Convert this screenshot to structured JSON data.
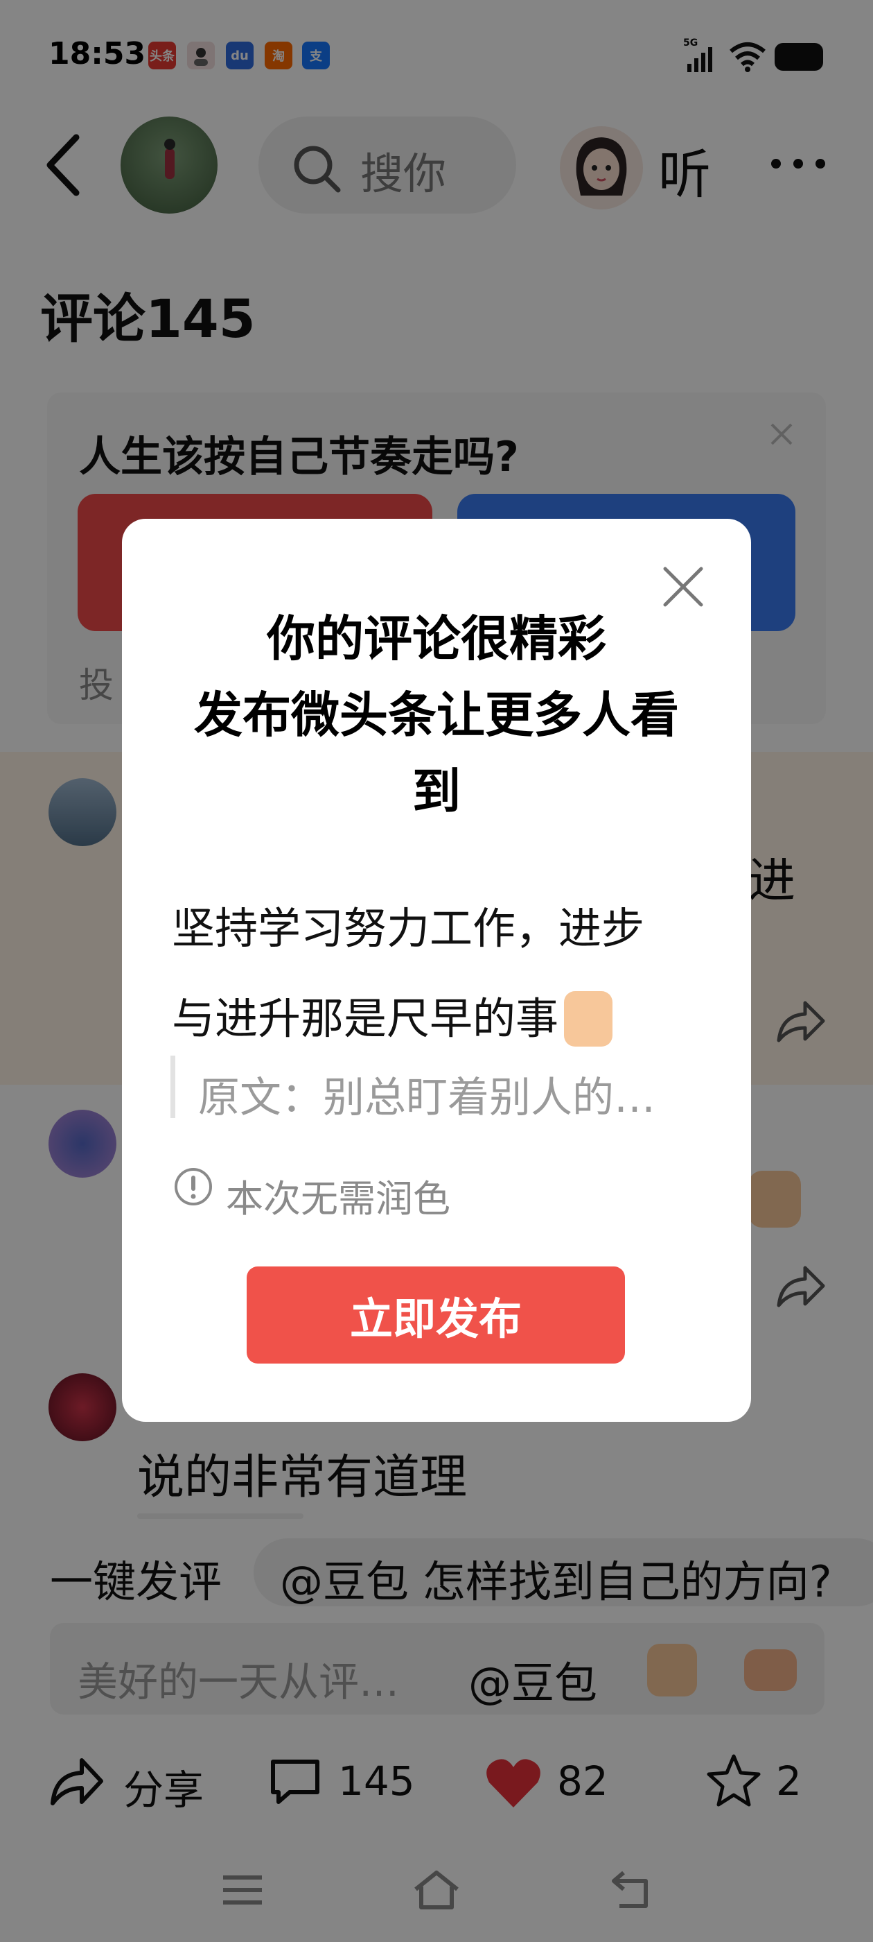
{
  "status_bar": {
    "time": "18:53",
    "apps": [
      "toutiao-icon",
      "avatar-icon",
      "baidu-icon",
      "taobao-icon",
      "alipay-icon"
    ],
    "app_badges": {
      "toutiao": "头条",
      "baidu": "du",
      "taobao": "淘",
      "alipay": "支"
    },
    "network": "5G"
  },
  "header": {
    "search_placeholder": "搜你",
    "listen_label": "听"
  },
  "comments_section": {
    "title": "评论145"
  },
  "poll": {
    "question": "人生该按自己节奏走吗?",
    "footer_text": "投",
    "colors": {
      "left": "#ef4a4a",
      "right": "#3b7bf2"
    }
  },
  "comments": [
    {
      "text_fragment": "进"
    },
    {
      "text": "说的非常有道理"
    }
  ],
  "quick_comment": {
    "label": "一键发评",
    "suggestion": "@豆包 怎样找到自己的方向?"
  },
  "input": {
    "placeholder": "美好的一天从评…",
    "at_label": "@豆包"
  },
  "actions": {
    "share_label": "分享",
    "comment_count": "145",
    "like_count": "82",
    "favorite_count": "2"
  },
  "modal": {
    "title_line1": "你的评论很精彩",
    "title_line2": "发布微头条让更多人看",
    "title_line3": "到",
    "body_line1": "坚持学习努力工作，进步",
    "body_line2": "与进升那是尺早的事",
    "quote": "原文：别总盯着别人的…",
    "hint": "本次无需润色",
    "publish_label": "立即发布"
  },
  "colors": {
    "accent_red": "#f0524a",
    "like_red": "#e8313a"
  }
}
